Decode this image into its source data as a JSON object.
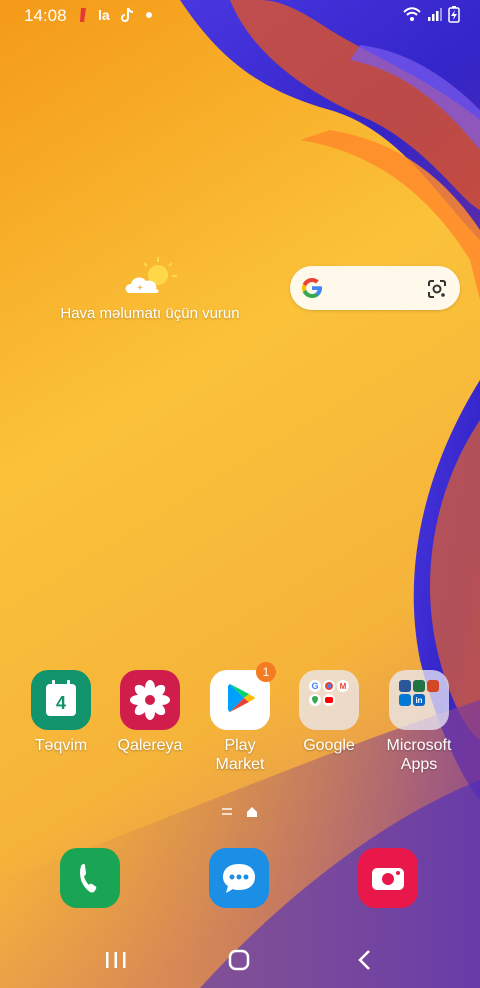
{
  "status_bar": {
    "time": "14:08",
    "notification_icons": [
      "red-app-icon",
      "la-app-icon",
      "tiktok-icon",
      "dot-icon"
    ],
    "right_icons": [
      "wifi-icon",
      "signal-icon",
      "battery-charging-icon"
    ]
  },
  "weather": {
    "label": "Hava məlumatı üçün vurun",
    "icon": "partly-cloudy-icon"
  },
  "search": {
    "left_icon": "google-g-icon",
    "right_icon": "google-lens-icon"
  },
  "apps": [
    {
      "label": "Təqvim",
      "icon": "calendar-icon",
      "day": "4",
      "color": "#11936c"
    },
    {
      "label": "Qalereya",
      "icon": "gallery-flower-icon",
      "color": "#d11d4c"
    },
    {
      "label": "Play Market",
      "label_line1": "Play",
      "label_line2": "Market",
      "icon": "google-play-icon",
      "badge": "1"
    },
    {
      "label": "Google",
      "icon": "folder-icon"
    },
    {
      "label": "Microsoft Apps",
      "label_line1": "Microsoft",
      "label_line2": "Apps",
      "icon": "folder-icon"
    }
  ],
  "dock": [
    {
      "icon": "phone-icon",
      "color": "#19a554"
    },
    {
      "icon": "messages-icon",
      "color": "#1b8fe5"
    },
    {
      "icon": "camera-icon",
      "color": "#e8184a"
    }
  ],
  "navigation": [
    "recents-icon",
    "home-icon",
    "back-icon"
  ],
  "colors": {
    "wallpaper_orange": "#f7a21f",
    "wallpaper_blue": "#3a2bd0",
    "accent_badge": "#f47b20"
  }
}
